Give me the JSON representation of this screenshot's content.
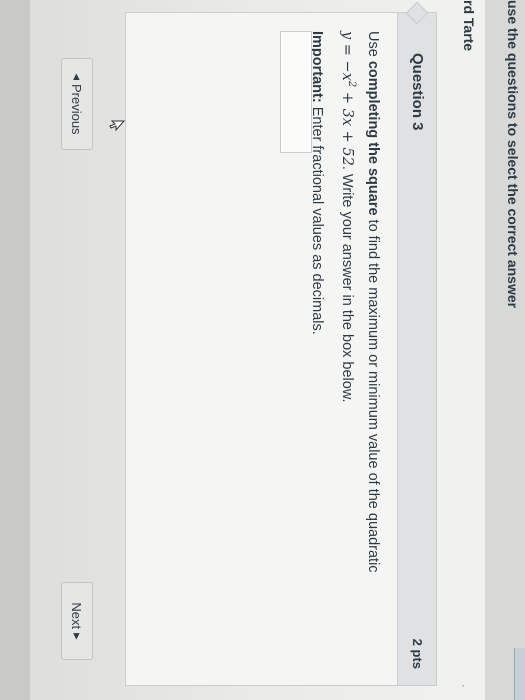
{
  "header": {
    "instruction": "use the questions to select the correct answer",
    "name_fragment": "rd Tarte",
    "side_mark": "·"
  },
  "question": {
    "title": "Question 3",
    "points": "2 pts",
    "line1_prefix": "Use ",
    "line1_bold": "completing the square",
    "line1_suffix": " to find the maximum or minimum value of the quadratic",
    "equation_a": "y = −x",
    "equation_exp": "2",
    "equation_b": " + 3x + 52",
    "line2_suffix": ". Write your answer in the box below.",
    "important_label": "Important:",
    "important_text": " Enter fractional values as decimals.",
    "answer_value": ""
  },
  "navigation": {
    "previous_label": "Previous",
    "previous_icon": "◂",
    "next_label": "Next",
    "next_icon": "▸"
  }
}
